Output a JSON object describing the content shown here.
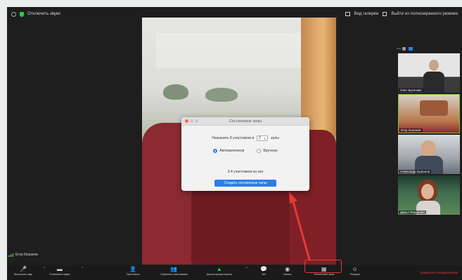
{
  "topbar": {
    "meeting_label": "Отключить звуки",
    "view_label": "Вид галереи",
    "fullscreen_label": "Выйти из полноэкранного режима"
  },
  "dialog": {
    "title": "Сессионные залы",
    "assign_label": "Назначить 8 участников в",
    "room_count": "2",
    "rooms_label": "залы",
    "option_auto": "Автоматически",
    "option_manual": "Вручную",
    "per_room_text": "3-4 участников на зал",
    "create_button": "Создать сессионные залы"
  },
  "participants": {
    "panel_badge": "— ▦",
    "tiles": [
      {
        "name": "Олег Бусянкин"
      },
      {
        "name": "Егор Кушаков"
      },
      {
        "name": "Александр Кушинов"
      },
      {
        "name": "Дарья Федорова"
      }
    ]
  },
  "self": {
    "name": "Егор Кушаков"
  },
  "toolbar": {
    "items": [
      {
        "label": "Выключить звук",
        "icon": "🎤"
      },
      {
        "label": "Остановить видео",
        "icon": "▬"
      },
      {
        "label": "Пригласить",
        "icon": "👤"
      },
      {
        "label": "Управлять участниками",
        "icon": "👥"
      },
      {
        "label": "Демонстрация экрана",
        "icon": "▲"
      },
      {
        "label": "Чат",
        "icon": "💬"
      },
      {
        "label": "Запись",
        "icon": "◉"
      },
      {
        "label": "Сессионные залы",
        "icon": "▦"
      },
      {
        "label": "Реакции",
        "icon": "☺"
      }
    ],
    "end_label": "Завершить конференцию"
  },
  "colors": {
    "accent_blue": "#2b7de9",
    "highlight_red": "#e53935",
    "active_speaker_border": "#7ec02a"
  }
}
